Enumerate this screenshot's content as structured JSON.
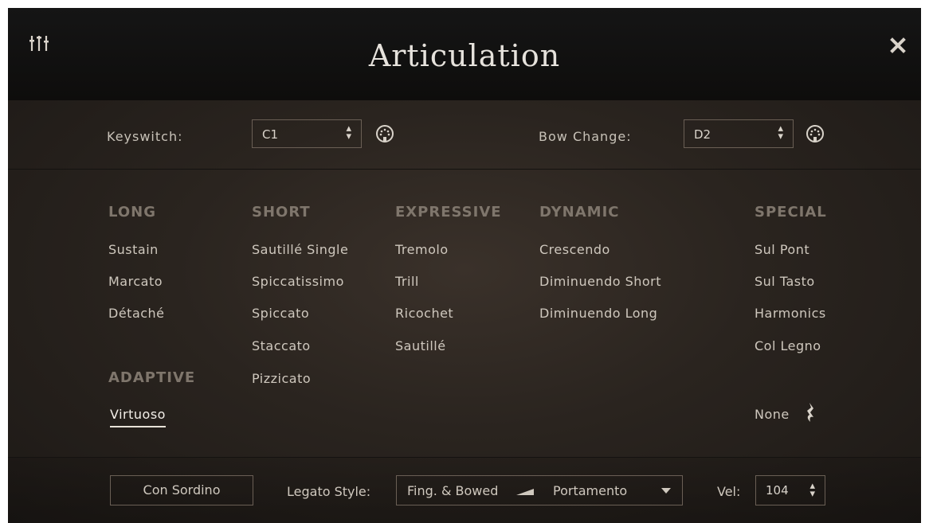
{
  "header": {
    "title": "Articulation",
    "mixer_icon": "mixer-sliders-icon",
    "close_icon": "close-icon"
  },
  "keyswitch": {
    "label": "Keyswitch:",
    "value": "C1",
    "bow_label": "Bow Change:",
    "bow_value": "D2",
    "spinner_glyph": "⬍"
  },
  "columns": {
    "long": {
      "title": "LONG",
      "items": [
        "Sustain",
        "Marcato",
        "Détaché"
      ]
    },
    "short": {
      "title": "SHORT",
      "items": [
        "Sautillé Single",
        "Spiccatissimo",
        "Spiccato",
        "Staccato",
        "Pizzicato"
      ]
    },
    "expressive": {
      "title": "EXPRESSIVE",
      "items": [
        "Tremolo",
        "Trill",
        "Ricochet",
        "Sautillé"
      ]
    },
    "dynamic": {
      "title": "DYNAMIC",
      "items": [
        "Crescendo",
        "Diminuendo Short",
        "Diminuendo Long"
      ]
    },
    "special": {
      "title": "SPECIAL",
      "items": [
        "Sul Pont",
        "Sul Tasto",
        "Harmonics",
        "Col Legno"
      ]
    },
    "adaptive": {
      "title": "ADAPTIVE",
      "items": [
        "Virtuoso"
      ]
    }
  },
  "none_label": "None",
  "footer": {
    "con_sordino": "Con Sordino",
    "legato_label": "Legato Style:",
    "legato_left": "Fing. & Bowed",
    "legato_right": "Portamento",
    "vel_label": "Vel:",
    "vel_value": "104"
  },
  "colors": {
    "header_bg": "#111111",
    "body_bg": "#2a241f",
    "text": "#cfc8be",
    "heading": "#7f766c"
  }
}
